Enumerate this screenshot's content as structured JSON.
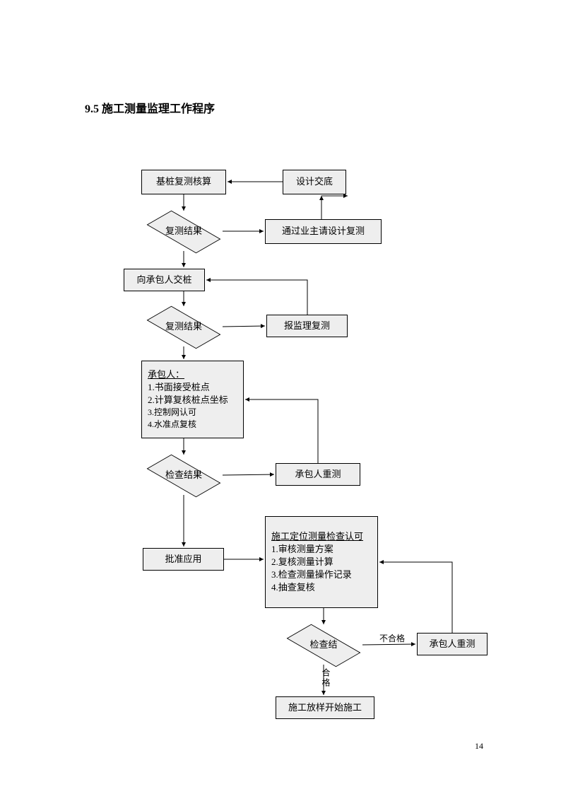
{
  "heading": "9.5 施工测量监理工作程序",
  "page_number": "14",
  "nodes": {
    "n1": "基桩复测核算",
    "n2": "设计交底",
    "n3": "复测结果",
    "n4": "通过业主请设计复测",
    "n5": "向承包人交桩",
    "n6": "复测结果",
    "n7": "报监理复测",
    "n8_title": "承包人：",
    "n8_1": "1.书面接受桩点",
    "n8_2": "2.计算复核桩点坐标",
    "n8_3": "3.控制网认可",
    "n8_4": "4.水准点复核",
    "n9": "检查结果",
    "n10": "承包人重测",
    "n11": "批准应用",
    "n12_title": "施工定位测量检查认可",
    "n12_1": "1.审核测量方案",
    "n12_2": "2.复核测量计算",
    "n12_3": "3.检查测量操作记录",
    "n12_4": "4.抽查复核",
    "n13": "检查结",
    "n14": "承包人重测",
    "n15": "施工放样开始施工"
  },
  "edge_labels": {
    "pass": "合格",
    "fail": "不合格"
  }
}
